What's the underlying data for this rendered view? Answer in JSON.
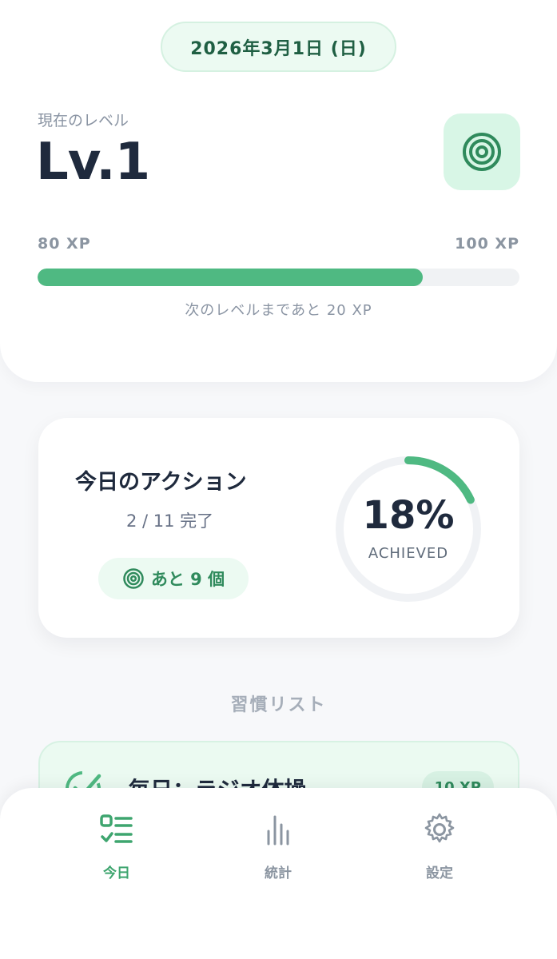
{
  "header": {
    "date": "2026年3月1日 (日)",
    "level_label": "現在のレベル",
    "level_value": "Lv.1",
    "level_icon": "target-icon"
  },
  "xp": {
    "current_label": "80 XP",
    "max_label": "100 XP",
    "progress": 0.8,
    "remaining_text": "次のレベルまであと 20 XP"
  },
  "today": {
    "title": "今日のアクション",
    "count_text": "2 / 11 完了",
    "remaining_label": "あと 9 個",
    "percent_text": "18%",
    "achieved_label": "ACHIEVED",
    "progress": 0.18
  },
  "habits": {
    "section_title": "習慣リスト",
    "items": [
      {
        "name": "毎日：ラジオ体操",
        "xp": "10 XP",
        "done": true
      }
    ]
  },
  "nav": {
    "items": [
      {
        "label": "今日",
        "icon": "checklist-icon",
        "active": true
      },
      {
        "label": "統計",
        "icon": "bar-chart-icon",
        "active": false
      },
      {
        "label": "設定",
        "icon": "gear-icon",
        "active": false
      }
    ]
  },
  "colors": {
    "accent": "#4fb982",
    "accent_dark": "#2f8a5c",
    "text_dark": "#1f2a3d",
    "muted": "#8b95a1"
  }
}
